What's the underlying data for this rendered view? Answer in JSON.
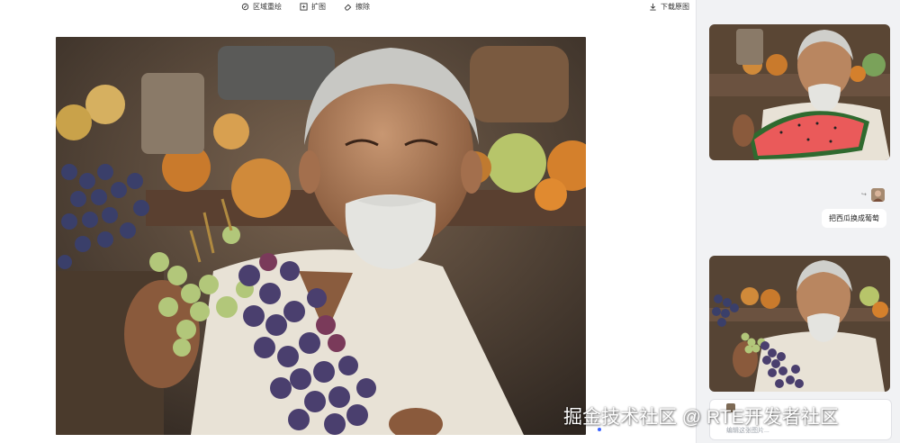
{
  "toolbar": {
    "region_redraw": "区域重绘",
    "expand": "扩图",
    "erase": "擦除",
    "download": "下载原图"
  },
  "main": {
    "image": "elderly man holding grapes",
    "scroll_indicator": "active"
  },
  "side": {
    "history": [
      {
        "image": "elderly man holding watermelon slice"
      },
      {
        "image": "elderly man holding grapes"
      }
    ],
    "user_message": "把西瓜换成葡萄",
    "input_placeholder": "编辑这张图片..."
  },
  "watermark": "掘金技术社区 @ RTE开发者社区",
  "colors": {
    "accent": "#3b63ff",
    "panel": "#f1f2f4",
    "canvas": "#ffffff"
  }
}
